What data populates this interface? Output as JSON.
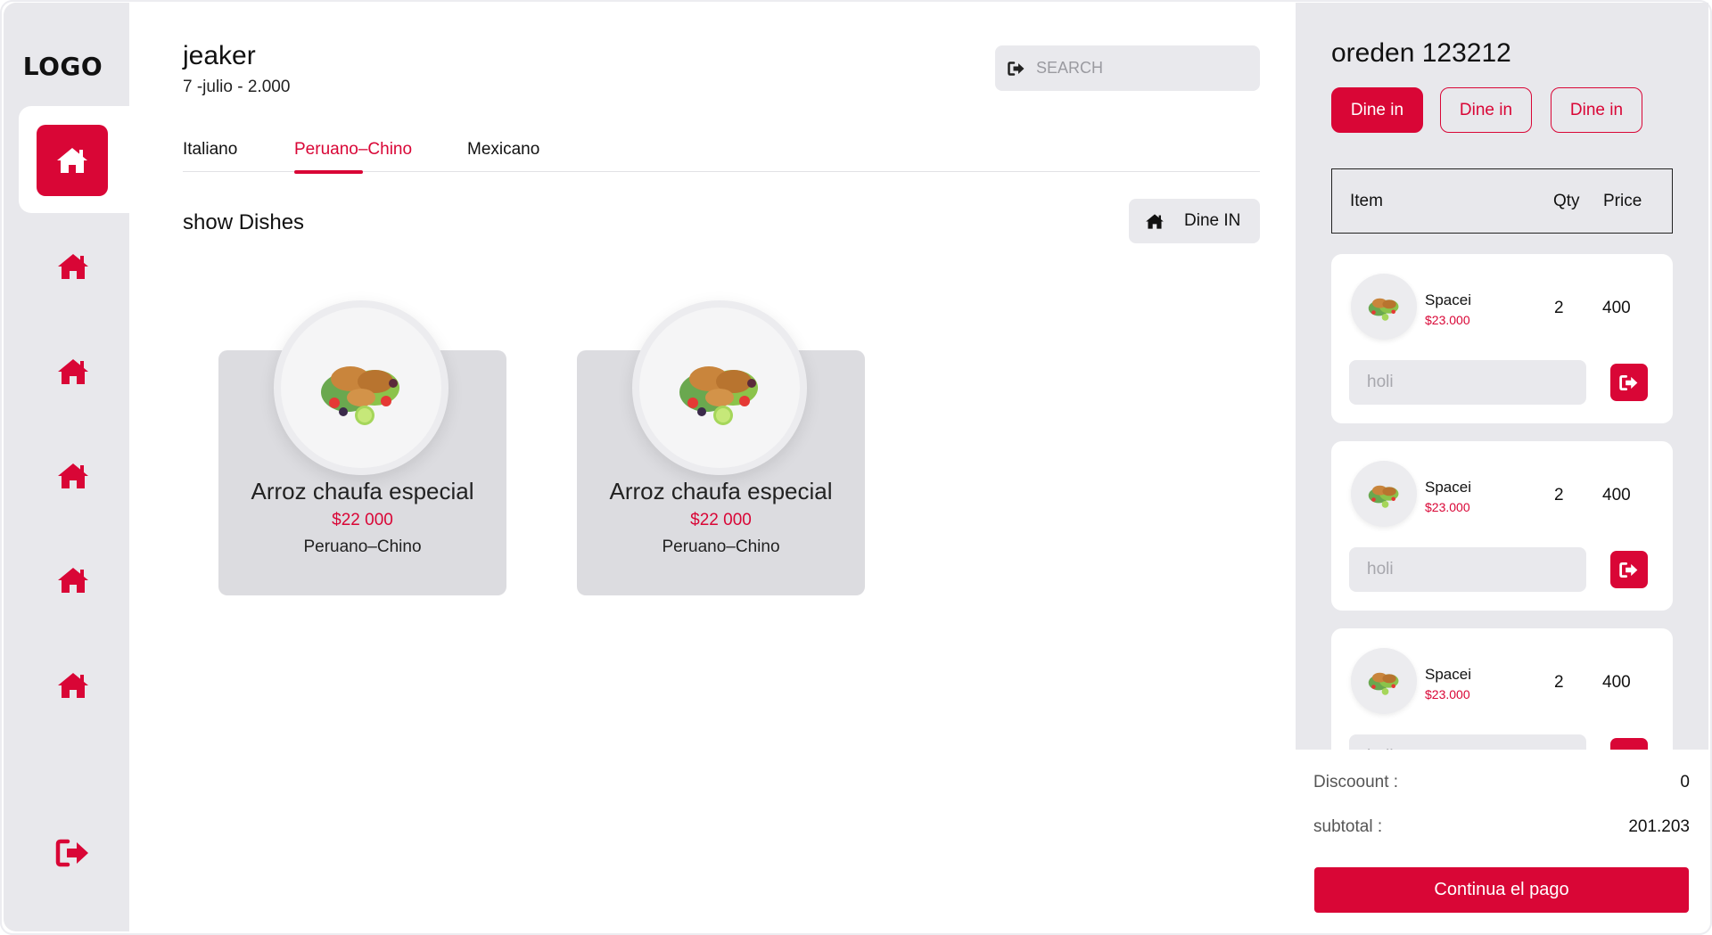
{
  "sidebar": {
    "logo": "LOGO",
    "nav_icons": [
      "home-icon",
      "home-icon",
      "home-icon",
      "home-icon",
      "home-icon",
      "home-icon"
    ],
    "logout_icon": "logout-icon",
    "accent": "#d90636"
  },
  "header": {
    "user_name": "jeaker",
    "date": "7 -julio - 2.000",
    "search_placeholder": "SEARCH"
  },
  "tabs": [
    {
      "label": "Italiano",
      "active": false
    },
    {
      "label": "Peruano–Chino",
      "active": true
    },
    {
      "label": "Mexicano",
      "active": false
    }
  ],
  "section": {
    "title": "show Dishes",
    "dine_button": "Dine IN"
  },
  "dishes": [
    {
      "name": "Arroz chaufa especial",
      "price": "$22 000",
      "category": "Peruano–Chino"
    },
    {
      "name": "Arroz chaufa especial",
      "price": "$22 000",
      "category": "Peruano–Chino"
    }
  ],
  "order": {
    "title": "oreden 123212",
    "types": [
      {
        "label": "Dine in",
        "active": true
      },
      {
        "label": "Dine in",
        "active": false
      },
      {
        "label": "Dine in",
        "active": false
      }
    ],
    "columns": {
      "item": "Item",
      "qty": "Qty",
      "price": "Price"
    },
    "items": [
      {
        "name": "Spacei",
        "unit_price": "$23.000",
        "qty": "2",
        "total": "400",
        "note_placeholder": "holi"
      },
      {
        "name": "Spacei",
        "unit_price": "$23.000",
        "qty": "2",
        "total": "400",
        "note_placeholder": "holi"
      },
      {
        "name": "Spacei",
        "unit_price": "$23.000",
        "qty": "2",
        "total": "400",
        "note_placeholder": "holi"
      }
    ],
    "discount_label": "Discoount :",
    "discount_value": "0",
    "subtotal_label": "subtotal :",
    "subtotal_value": "201.203",
    "pay_button": "Continua el pago"
  }
}
